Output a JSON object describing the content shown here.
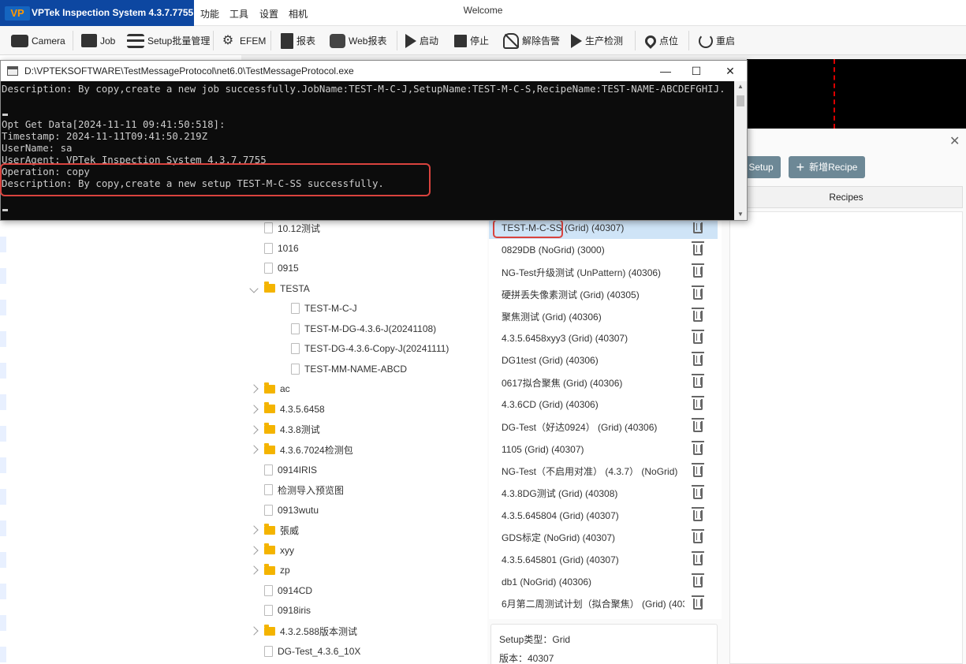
{
  "app": {
    "logo": "VP",
    "title": "VPTek Inspection System 4.3.7.7755",
    "window_title": "Welcome",
    "menu": [
      "功能",
      "工具",
      "设置",
      "相机"
    ]
  },
  "toolbar": {
    "camera": "Camera",
    "job": "Job",
    "setup_batch": "Setup批量管理",
    "efem": "EFEM",
    "report": "报表",
    "web_report": "Web报表",
    "start": "启动",
    "stop": "停止",
    "clear_alarm": "解除告警",
    "production": "生产检测",
    "point": "点位",
    "restart": "重启"
  },
  "console": {
    "title": "D:\\VPTEKSOFTWARE\\TestMessageProtocol\\net6.0\\TestMessageProtocol.exe",
    "lines": [
      "Description: By copy,create a new job successfully.JobName:TEST-M-C-J,SetupName:TEST-M-C-S,RecipeName:TEST-NAME-ABCDEFGHIJ.",
      "",
      "",
      "Opt Get Data[2024-11-11 09:41:50:518]:",
      "Timestamp: 2024-11-11T09:41:50.219Z",
      "UserName: sa",
      "UserAgent: VPTek Inspection System 4.3.7.7755",
      "Operation: copy",
      "Description: By copy,create a new setup TEST-M-C-SS successfully."
    ]
  },
  "dialog": {
    "setup_button": "Setup",
    "new_recipe_button": "新增Recipe",
    "recipes_header": "Recipes"
  },
  "tree": [
    {
      "label": "10.12测试",
      "type": "file",
      "level": 1
    },
    {
      "label": "1016",
      "type": "file",
      "level": 1
    },
    {
      "label": "0915",
      "type": "file",
      "level": 1
    },
    {
      "label": "TESTA",
      "type": "folder-open",
      "level": 1
    },
    {
      "label": "TEST-M-C-J",
      "type": "file",
      "level": 2
    },
    {
      "label": "TEST-M-DG-4.3.6-J(20241108)",
      "type": "file",
      "level": 2
    },
    {
      "label": "TEST-DG-4.3.6-Copy-J(20241111)",
      "type": "file",
      "level": 2
    },
    {
      "label": "TEST-MM-NAME-ABCD",
      "type": "file",
      "level": 2
    },
    {
      "label": "ac",
      "type": "folder",
      "level": 1
    },
    {
      "label": "4.3.5.6458",
      "type": "folder",
      "level": 1
    },
    {
      "label": "4.3.8测试",
      "type": "folder",
      "level": 1
    },
    {
      "label": "4.3.6.7024检测包",
      "type": "folder",
      "level": 1
    },
    {
      "label": "0914IRIS",
      "type": "file",
      "level": 1
    },
    {
      "label": "检测导入预览图",
      "type": "file",
      "level": 1
    },
    {
      "label": "0913wutu",
      "type": "file",
      "level": 1
    },
    {
      "label": "張威",
      "type": "folder",
      "level": 1
    },
    {
      "label": "xyy",
      "type": "folder",
      "level": 1
    },
    {
      "label": "zp",
      "type": "folder",
      "level": 1
    },
    {
      "label": "0914CD",
      "type": "file",
      "level": 1
    },
    {
      "label": "0918iris",
      "type": "file",
      "level": 1
    },
    {
      "label": "4.3.2.588版本测试",
      "type": "folder",
      "level": 1
    },
    {
      "label": "DG-Test_4.3.6_10X",
      "type": "file",
      "level": 1
    }
  ],
  "setups": [
    "TEST-M-C-SS (Grid) (40307)",
    "0829DB (NoGrid) (3000)",
    "NG-Test升级测试 (UnPattern) (40306)",
    "硬拼丢失像素测试 (Grid) (40305)",
    "聚焦测试 (Grid) (40306)",
    "4.3.5.6458xyy3 (Grid) (40307)",
    "DG1test (Grid) (40306)",
    "0617拟合聚焦 (Grid) (40306)",
    "4.3.6CD (Grid) (40306)",
    "DG-Test（好达0924） (Grid) (40306)",
    "1105 (Grid) (40307)",
    "NG-Test（不启用对准） (4.3.7） (NoGrid)",
    "4.3.8DG测试 (Grid) (40308)",
    "4.3.5.645804 (Grid) (40307)",
    "GDS标定 (NoGrid) (40307)",
    "4.3.5.645801 (Grid) (40307)",
    "db1 (NoGrid) (40306)",
    "6月第二周测试计划（拟合聚焦） (Grid) (403"
  ],
  "info": {
    "setup_type": "Setup类型：Grid",
    "version": "版本：40307"
  }
}
